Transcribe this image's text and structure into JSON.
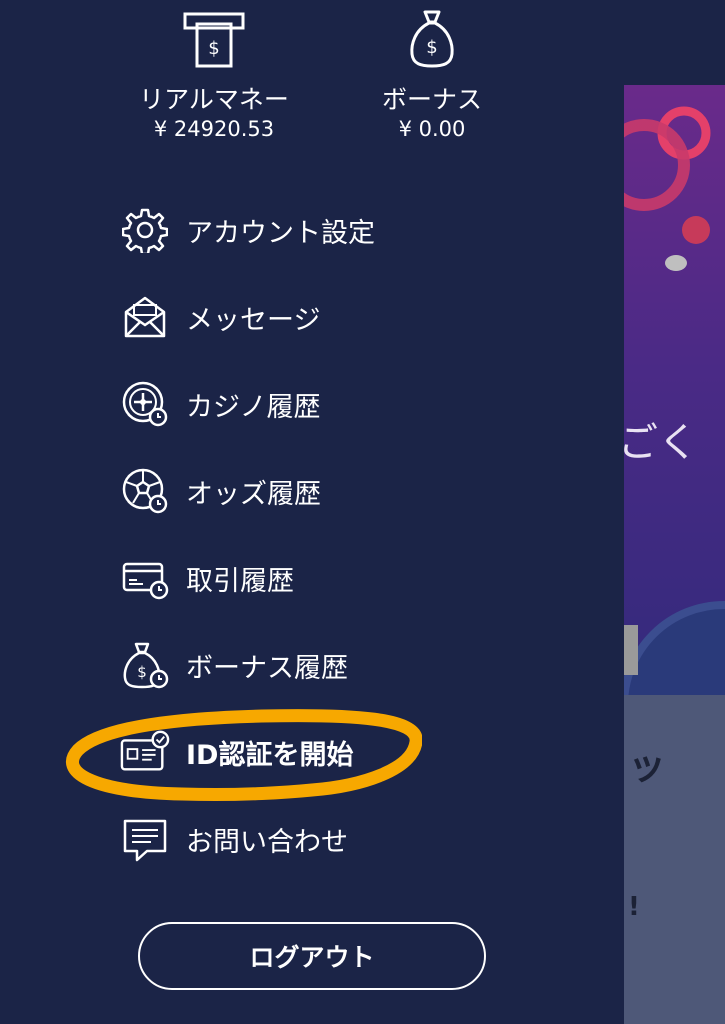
{
  "wallet": {
    "real": {
      "label": "リアルマネー",
      "value": "¥ 24920.53",
      "icon": "atm-cash-icon"
    },
    "bonus": {
      "label": "ボーナス",
      "value": "¥ 0.00",
      "icon": "money-bag-icon"
    }
  },
  "menu": [
    {
      "id": "account-settings",
      "label": "アカウント設定",
      "icon": "gear-icon"
    },
    {
      "id": "messages",
      "label": "メッセージ",
      "icon": "envelope-icon"
    },
    {
      "id": "casino-history",
      "label": "カジノ履歴",
      "icon": "roulette-history-icon"
    },
    {
      "id": "odds-history",
      "label": "オッズ履歴",
      "icon": "soccer-ball-history-icon"
    },
    {
      "id": "transaction-history",
      "label": "取引履歴",
      "icon": "card-history-icon"
    },
    {
      "id": "bonus-history",
      "label": "ボーナス履歴",
      "icon": "money-bag-history-icon"
    },
    {
      "id": "start-id-verification",
      "label": "ID認証を開始",
      "icon": "id-card-check-icon"
    },
    {
      "id": "contact",
      "label": "お問い合わせ",
      "icon": "chat-icon"
    }
  ],
  "logout_label": "ログアウト",
  "background": {
    "promo_text": "ごく",
    "card_title": "ッ",
    "card_text": "!"
  },
  "colors": {
    "drawer_bg": "#1b2447",
    "text": "#ffffff",
    "highlight_ring": "#f7a800"
  }
}
